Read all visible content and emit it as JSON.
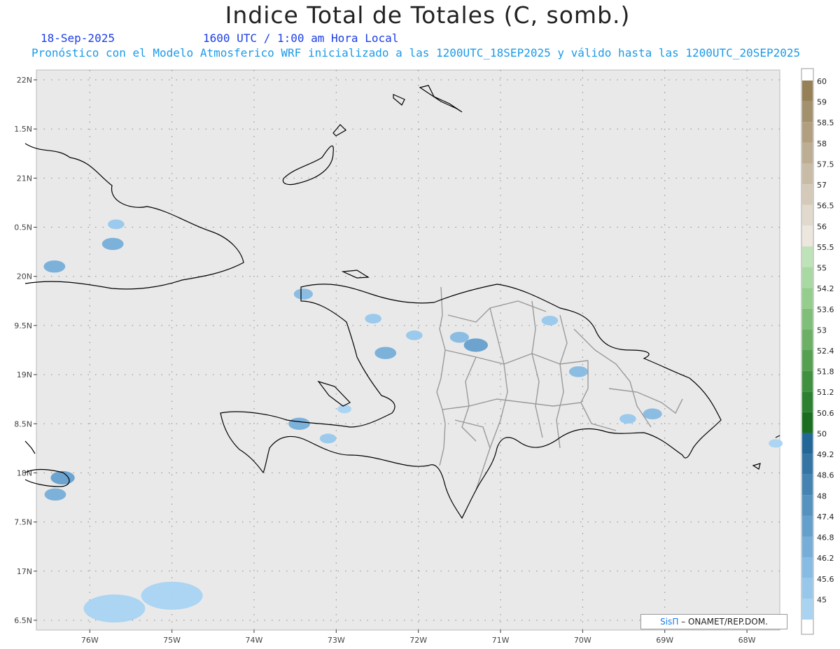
{
  "header": {
    "title": "Indice Total de Totales (C, somb.)",
    "date": "18-Sep-2025",
    "valid_time": "1600 UTC / 1:00 am Hora Local",
    "model_info": "Pronóstico con el Modelo Atmosferico WRF inicializado a las 1200UTC_18SEP2025 y válido hasta las  1200UTC_20SEP2025"
  },
  "credit": {
    "brand": "SisΠ",
    "org": "– ONAMET/REP.DOM."
  },
  "colors": {
    "map_background": "#e9e9e9",
    "coastline": "#000000",
    "province_border": "#9a9a9a",
    "shade_low": "#9dcfef",
    "shade_mid": "#6aa6d2",
    "shade_high": "#4b86b6"
  },
  "chart_data": {
    "type": "heatmap",
    "title": "Indice Total de Totales (C, somb.)",
    "xlabel": "",
    "ylabel": "",
    "xlim": [
      -76.65,
      -67.6
    ],
    "ylim": [
      16.4,
      22.1
    ],
    "x_ticks": [
      -76,
      -75,
      -74,
      -73,
      -72,
      -71,
      -70,
      -69,
      -68
    ],
    "x_tick_labels": [
      "76W",
      "75W",
      "74W",
      "73W",
      "72W",
      "71W",
      "70W",
      "69W",
      "68W"
    ],
    "y_ticks": [
      16.5,
      17,
      17.5,
      18,
      18.5,
      19,
      19.5,
      20,
      20.5,
      21,
      21.5,
      22
    ],
    "y_tick_labels": [
      "6.5N",
      "17N",
      "7.5N",
      "18N",
      "8.5N",
      "19N",
      "9.5N",
      "20N",
      "0.5N",
      "21N",
      "1.5N",
      "22N"
    ],
    "grid": true,
    "legend_position": "right",
    "colorbar": {
      "levels": [
        "45",
        "45.6",
        "46.2",
        "46.8",
        "47.4",
        "48",
        "48.6",
        "49.2",
        "50",
        "50.6",
        "51.2",
        "51.8",
        "52.4",
        "53",
        "53.6",
        "54.2",
        "55",
        "55.5",
        "56",
        "56.5",
        "57",
        "57.5",
        "58",
        "58.5",
        "59",
        "60"
      ],
      "colors": [
        "#a8d4f2",
        "#97c8ec",
        "#86bbe3",
        "#76aed9",
        "#65a0cd",
        "#5592c0",
        "#4483b2",
        "#3475a5",
        "#236799",
        "#1b6e1f",
        "#2d802f",
        "#3f913f",
        "#55a151",
        "#6bb065",
        "#80bf79",
        "#95cd8d",
        "#a9d9a2",
        "#bfe3b8",
        "#ece6dd",
        "#e1d9cc",
        "#d5cab9",
        "#c9bca6",
        "#bdad92",
        "#b19f7f",
        "#a3906c",
        "#968058"
      ]
    },
    "shaded_regions": [
      {
        "lon": -76.43,
        "lat": 20.1,
        "level": 46.8
      },
      {
        "lon": -75.68,
        "lat": 20.53,
        "level": 45.6
      },
      {
        "lon": -75.72,
        "lat": 20.33,
        "level": 46.8
      },
      {
        "lon": -73.4,
        "lat": 19.82,
        "level": 46.2
      },
      {
        "lon": -72.55,
        "lat": 19.57,
        "level": 45.6
      },
      {
        "lon": -72.4,
        "lat": 19.22,
        "level": 46.8
      },
      {
        "lon": -72.05,
        "lat": 19.4,
        "level": 45.6
      },
      {
        "lon": -71.3,
        "lat": 19.3,
        "level": 47.4
      },
      {
        "lon": -71.5,
        "lat": 19.38,
        "level": 46.2
      },
      {
        "lon": -73.45,
        "lat": 18.5,
        "level": 46.8
      },
      {
        "lon": -73.1,
        "lat": 18.35,
        "level": 45.6
      },
      {
        "lon": -72.9,
        "lat": 18.65,
        "level": 45
      },
      {
        "lon": -70.4,
        "lat": 19.55,
        "level": 45.6
      },
      {
        "lon": -70.05,
        "lat": 19.03,
        "level": 46.2
      },
      {
        "lon": -69.15,
        "lat": 18.6,
        "level": 46.2
      },
      {
        "lon": -69.45,
        "lat": 18.55,
        "level": 45.6
      },
      {
        "lon": -76.33,
        "lat": 17.95,
        "level": 47.4
      },
      {
        "lon": -76.42,
        "lat": 17.78,
        "level": 46.8
      },
      {
        "lon": -75.7,
        "lat": 16.62,
        "level": 45
      },
      {
        "lon": -75.0,
        "lat": 16.75,
        "level": 45
      },
      {
        "lon": -67.65,
        "lat": 18.3,
        "level": 45
      }
    ]
  }
}
